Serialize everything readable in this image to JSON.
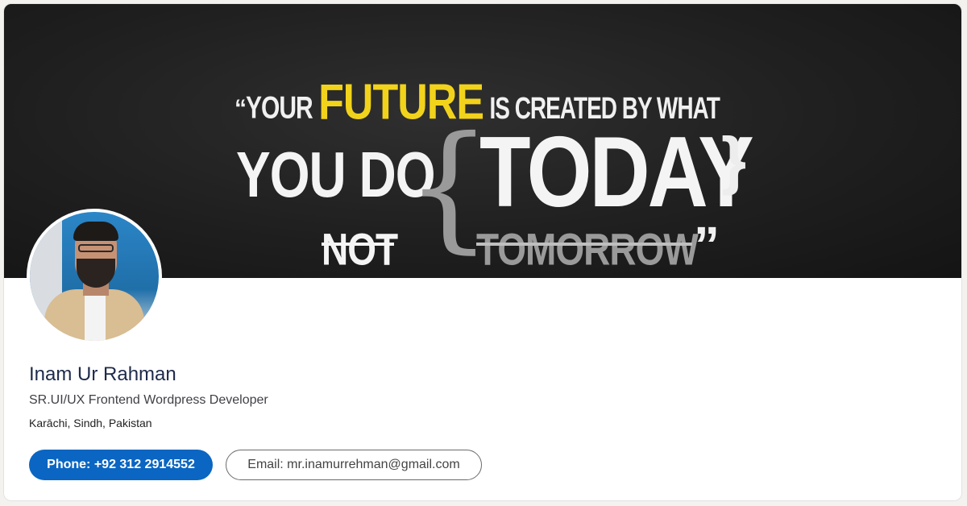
{
  "banner": {
    "quote_open": "“",
    "word_your": "YOUR",
    "word_future": "FUTURE",
    "phrase_created": "IS CREATED BY WHAT",
    "phrase_you_do": "YOU DO",
    "brace_left": "{",
    "word_today": "TODAY",
    "brace_right": "}",
    "word_not": "NOT",
    "word_tomorrow": "TOMORROW",
    "quote_close": "”",
    "colors": {
      "background": "#1f1f1f",
      "accent": "#f2d31b",
      "muted": "#9a9a9a"
    }
  },
  "profile": {
    "name": "Inam Ur Rahman",
    "headline": "SR.UI/UX Frontend Wordpress Developer",
    "location": "Karāchi, Sindh, Pakistan"
  },
  "actions": {
    "phone_label": "Phone: +92 312 2914552",
    "email_label": "Email: mr.inamurrehman@gmail.com"
  },
  "colors": {
    "primary": "#0a66c2",
    "name_text": "#1d2a4a"
  }
}
